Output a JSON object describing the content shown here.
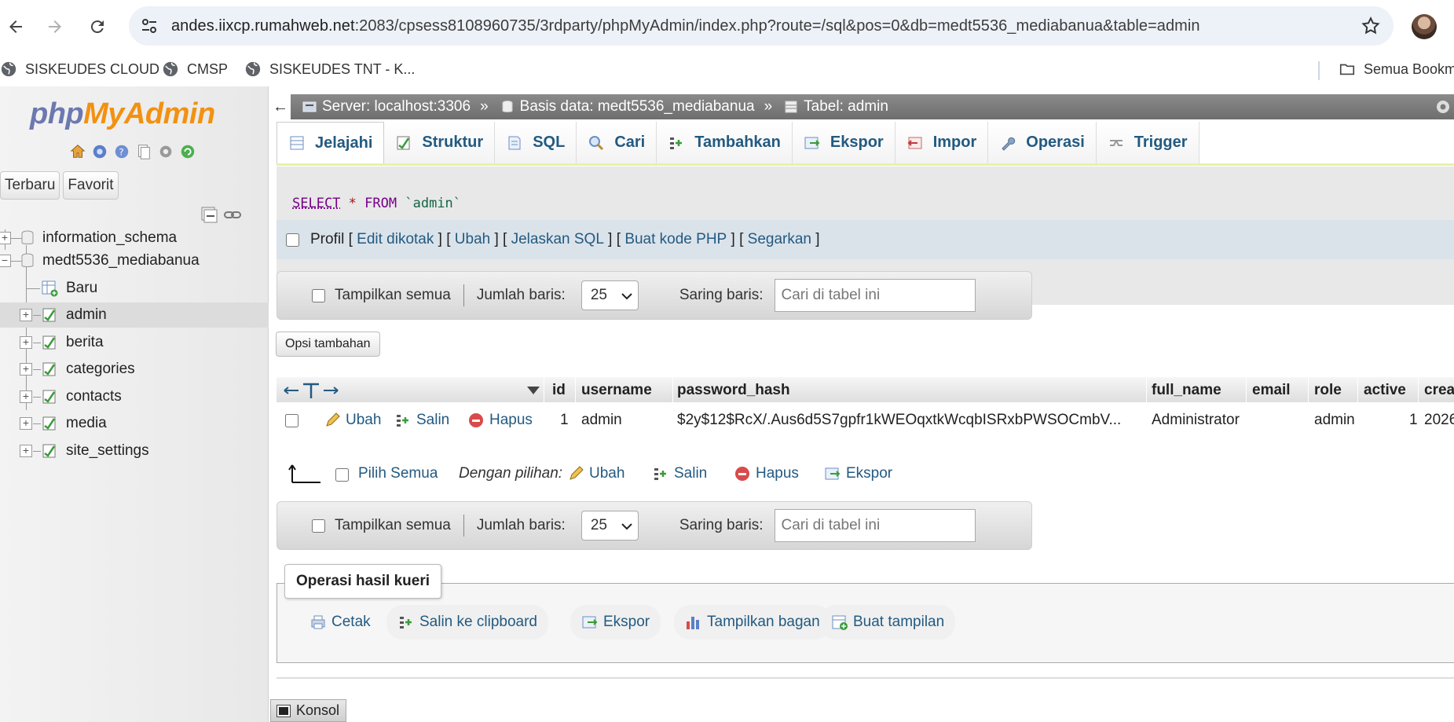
{
  "browser": {
    "url_host": "andes.iixcp.rumahweb.net",
    "url_rest": ":2083/cpsess8108960735/3rdparty/phpMyAdmin/index.php?route=/sql&pos=0&db=medt5536_mediabanua&table=admin",
    "bookmarks": [
      "SISKEUDES CLOUD",
      "CMSP",
      "SISKEUDES TNT - K...",
      "Semua Bookm"
    ]
  },
  "sidebar": {
    "logo_php": "php",
    "logo_my": "My",
    "logo_admin": "Admin",
    "tabs": [
      "Terbaru",
      "Favorit"
    ],
    "databases": [
      "information_schema",
      "medt5536_mediabanua"
    ],
    "tables": [
      "Baru",
      "admin",
      "berita",
      "categories",
      "contacts",
      "media",
      "site_settings"
    ]
  },
  "breadcrumb": {
    "server": "Server: localhost:3306",
    "database": "Basis data: medt5536_mediabanua",
    "table": "Tabel: admin",
    "sep": "»"
  },
  "tabs": [
    "Jelajahi",
    "Struktur",
    "SQL",
    "Cari",
    "Tambahkan",
    "Ekspor",
    "Impor",
    "Operasi",
    "Trigger"
  ],
  "sql": {
    "kw_select": "SELECT",
    "star": "*",
    "kw_from": "FROM",
    "table": "`admin`"
  },
  "sql_actions": {
    "profil": "Profil",
    "links": [
      "Edit dikotak",
      "Ubah",
      "Jelaskan SQL",
      "Buat kode PHP",
      "Segarkan"
    ]
  },
  "navbar": {
    "show_all": "Tampilkan semua",
    "rows_label": "Jumlah baris:",
    "rows_value": "25",
    "filter_label": "Saring baris:",
    "filter_placeholder": "Cari di tabel ini"
  },
  "extra_options": "Opsi tambahan",
  "grid": {
    "columns": [
      "id",
      "username",
      "password_hash",
      "full_name",
      "email",
      "role",
      "active",
      "crea"
    ],
    "row": {
      "actions": [
        "Ubah",
        "Salin",
        "Hapus"
      ],
      "id": "1",
      "username": "admin",
      "password_hash": "$2y$12$RcX/.Aus6d5S7gpfr1kWEOqxtkWcqbISRxbPWSOCmbV...",
      "full_name": "Administrator",
      "email": "",
      "role": "admin",
      "active": "1",
      "created": "2026"
    }
  },
  "bulk": {
    "select_all": "Pilih Semua",
    "with_selected": "Dengan pilihan:",
    "actions": [
      "Ubah",
      "Salin",
      "Hapus",
      "Ekspor"
    ]
  },
  "query_results": {
    "legend": "Operasi hasil kueri",
    "buttons": [
      "Cetak",
      "Salin ke clipboard",
      "Ekspor",
      "Tampilkan bagan",
      "Buat tampilan"
    ]
  },
  "console": "Konsol",
  "colors": {
    "link": "#235a81",
    "topbar": "#7a7a7a",
    "tab_underline": "#e4f4a6",
    "logo_blue": "#6c78af",
    "logo_orange": "#f29111"
  }
}
